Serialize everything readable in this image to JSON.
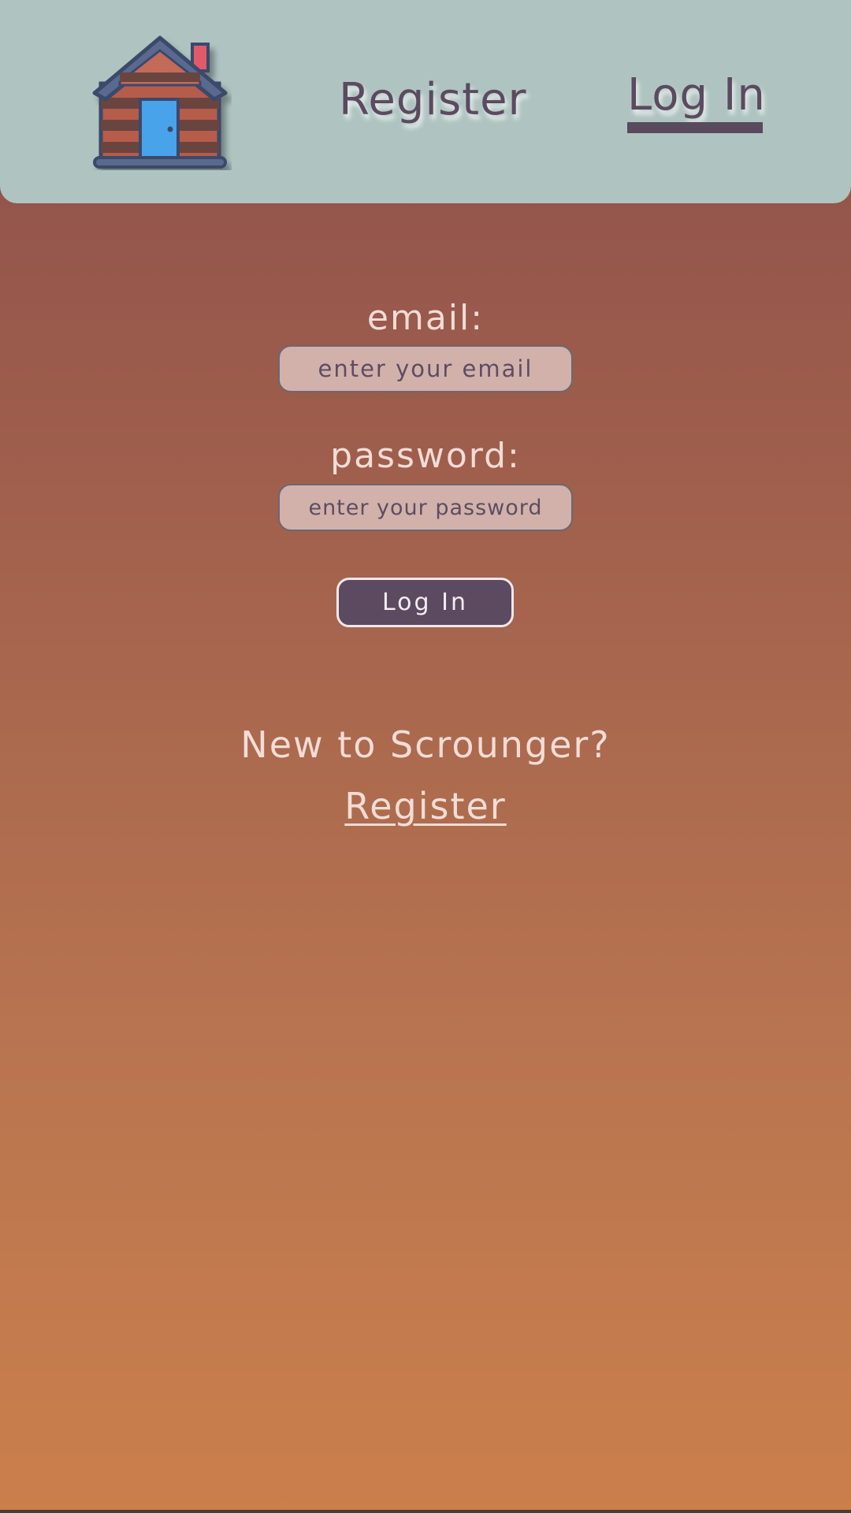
{
  "header": {
    "nav": {
      "register_label": "Register",
      "login_label": "Log In"
    }
  },
  "form": {
    "email_label": "email:",
    "email_placeholder": "enter your email",
    "email_value": "",
    "password_label": "password:",
    "password_placeholder": "enter your password",
    "password_value": "",
    "submit_label": "Log In"
  },
  "footer": {
    "prompt": "New to Scrounger?",
    "register_link": "Register"
  },
  "colors": {
    "header_bg": "#afc4c1",
    "accent": "#5c4a60",
    "text_light": "#f3dcd6",
    "input_bg": "#d2b1ab",
    "page_gradient_top": "#8c4e4a",
    "page_gradient_bottom": "#cb7f4b"
  },
  "icons": {
    "logo": "log-cabin-icon"
  }
}
